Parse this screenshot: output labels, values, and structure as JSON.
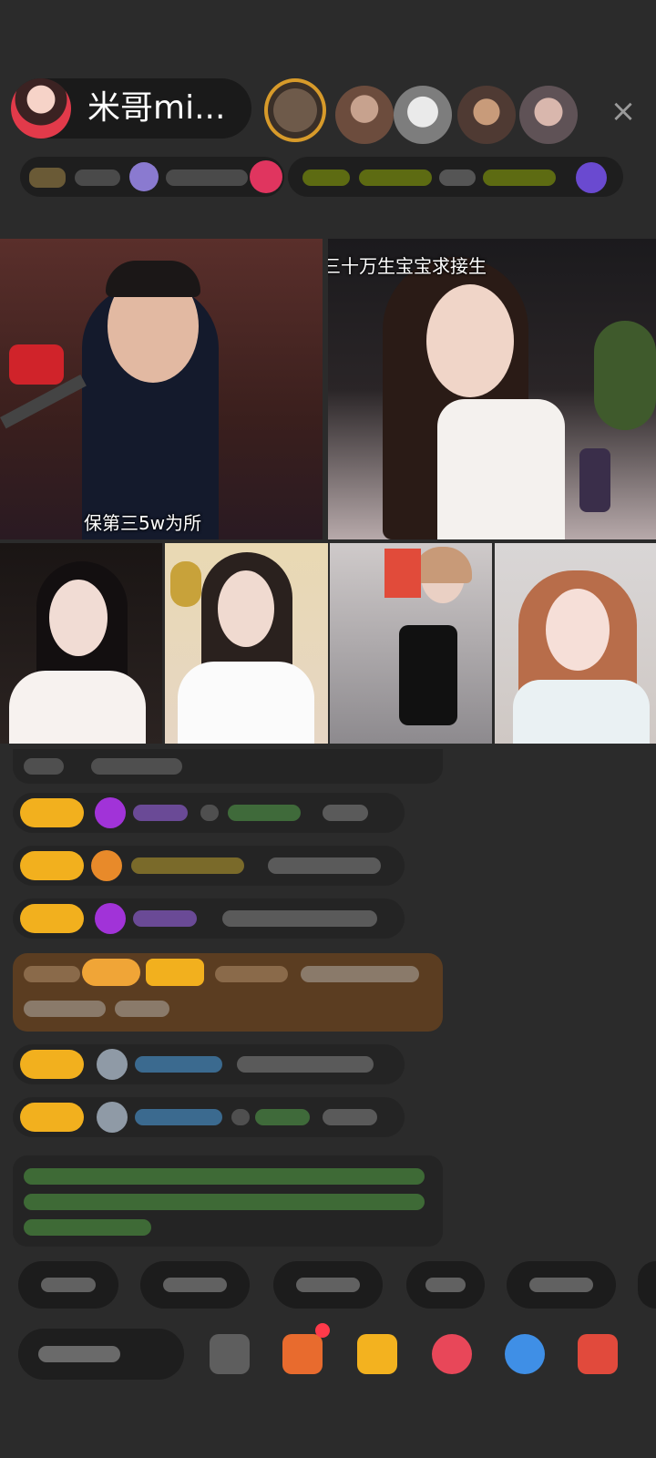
{
  "host": {
    "name": "米哥mi..."
  },
  "top_bar": {
    "close_icon": "×"
  },
  "videos": {
    "tile1_caption": "保第三5w为所",
    "tile2_caption": "三十万生宝宝求接生"
  },
  "colors": {
    "background": "#2b2b2b",
    "tag_yellow": "#f2b01e",
    "highlight_brown": "#5b3d21",
    "green_text": "#3e9a3a",
    "blue_name": "#3b8fc6"
  }
}
